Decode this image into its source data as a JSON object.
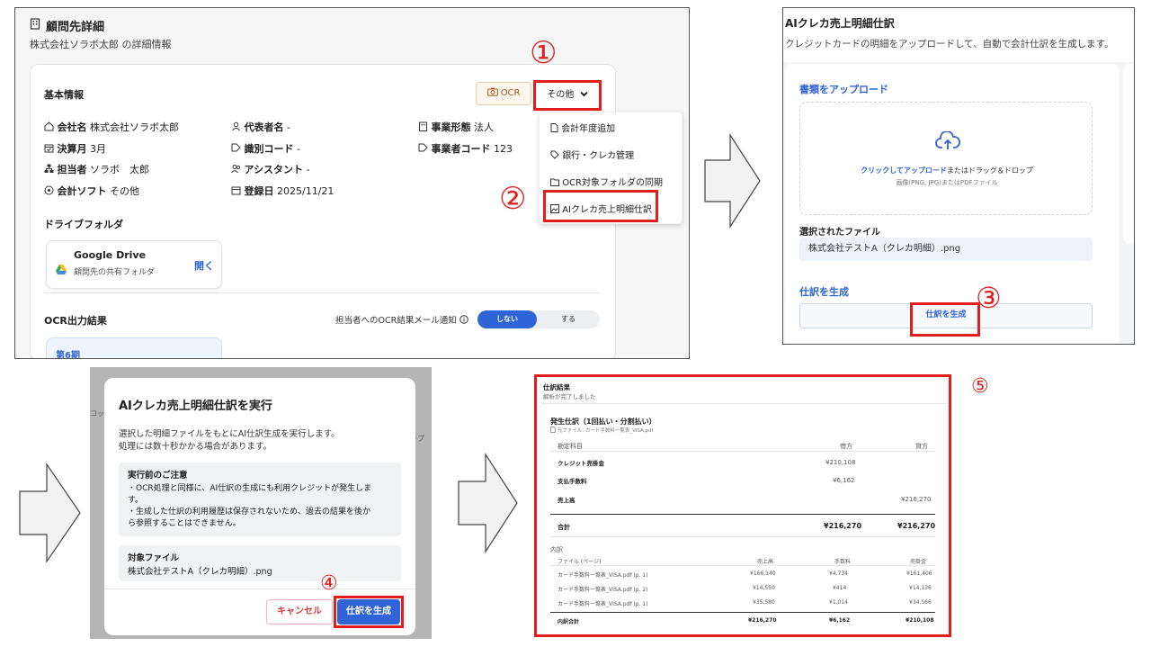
{
  "panel1": {
    "title": "顧問先詳細",
    "subtitle": "株式会社ソラボ太郎 の詳細情報",
    "basic_info_heading": "基本情報",
    "ocr_button": "OCR",
    "other_button": "その他",
    "fields": {
      "company_label": "会社名",
      "company_value": "株式会社ソラボ太郎",
      "rep_label": "代表者名",
      "rep_value": "-",
      "business_type_label": "事業形態",
      "business_type_value": "法人",
      "fiscal_month_label": "決算月",
      "fiscal_month_value": "3月",
      "id_code_label": "識別コード",
      "id_code_value": "-",
      "business_code_label": "事業者コード",
      "business_code_value": "123",
      "manager_label": "担当者",
      "manager_value": "ソラボ　太郎",
      "assistant_label": "アシスタント",
      "assistant_value": "-",
      "software_label": "会計ソフト",
      "software_value": "その他",
      "registered_label": "登録日",
      "registered_value": "2025/11/21"
    },
    "menu": {
      "item1": "会計年度追加",
      "item2": "銀行・クレカ管理",
      "item3": "OCR対象フォルダの同期",
      "item4": "AIクレカ売上明細仕訳"
    },
    "drive_heading": "ドライブフォルダ",
    "drive_title": "Google Drive",
    "drive_sub": "顧問先の共有フォルダ",
    "drive_open": "開く",
    "ocr_results_heading": "OCR出力結果",
    "notify_label": "担当者へのOCR結果メール通知",
    "toggle_off_label": "しない",
    "toggle_on_label": "する",
    "period_label": "第6期",
    "step1": "①",
    "step2": "②"
  },
  "panel2": {
    "title": "AIクレカ売上明細仕訳",
    "subtitle": "クレジットカードの明細をアップロードして、自動で会計仕訳を生成します。",
    "upload_heading": "書類をアップロード",
    "drop_link": "クリックしてアップロード",
    "drop_rest": "またはドラッグ＆ドロップ",
    "drop_hint": "画像(PNG, JPG)またはPDFファイル",
    "selected_heading": "選択されたファイル",
    "selected_file": "株式会社テストA（クレカ明細）.png",
    "generate_heading": "仕訳を生成",
    "generate_button": "仕訳を生成",
    "step3": "③"
  },
  "panel3": {
    "title": "AIクレカ売上明細仕訳を実行",
    "desc1": "選択した明細ファイルをもとにAI仕訳生成を実行します。",
    "desc2": "処理には数十秒かかる場合があります。",
    "note_title": "実行前のご注意",
    "note1": "・OCR処理と同様に、AI仕訳の生成にも利用クレジットが発生しま",
    "note1b": "す。",
    "note2": "・生成した仕訳の利用履歴は保存されないため、過去の結果を後か",
    "note2b": "ら参照することはできません。",
    "target_title": "対象ファイル",
    "target_file": "株式会社テストA（クレカ明細）.png",
    "cancel_button": "キャンセル",
    "generate_button": "仕訳を生成",
    "step4": "④",
    "bg_text1": "コッ",
    "bg_text2": "ップ"
  },
  "panel4": {
    "title": "仕訳結果",
    "subtitle": "解析が完了しました",
    "section_title": "発生仕訳（1回払い・分割払い）",
    "source_file": "元ファイル: カード手数料一覧表_VISA.pdf",
    "col_account": "勘定科目",
    "col_debit": "借方",
    "col_credit": "貸方",
    "rows": [
      {
        "account": "クレジット売掛金",
        "debit": "¥210,108",
        "credit": ""
      },
      {
        "account": "支払手数料",
        "debit": "¥6,162",
        "credit": ""
      },
      {
        "account": "売上高",
        "debit": "",
        "credit": "¥216,270"
      }
    ],
    "total_label": "合計",
    "total_debit": "¥216,270",
    "total_credit": "¥216,270",
    "breakdown_heading": "内訳",
    "bcol_file": "ファイル (ページ)",
    "bcol_sales": "売上高",
    "bcol_fee": "手数料",
    "bcol_receivable": "売掛金",
    "brows": [
      {
        "file": "カード手数料一覧表_VISA.pdf (p. 1)",
        "sales": "¥166,140",
        "fee": "¥4,734",
        "receivable": "¥161,406"
      },
      {
        "file": "カード手数料一覧表_VISA.pdf (p. 2)",
        "sales": "¥14,550",
        "fee": "¥414",
        "receivable": "¥14,136"
      },
      {
        "file": "カード手数料一覧表_VISA.pdf (p. 1)",
        "sales": "¥35,580",
        "fee": "¥1,014",
        "receivable": "¥34,566"
      }
    ],
    "btotal_label": "内訳合計",
    "btotal_sales": "¥216,270",
    "btotal_fee": "¥6,162",
    "btotal_receivable": "¥210,108",
    "step5": "⑤"
  },
  "colors": {
    "accent_blue": "#2f63d8",
    "highlight_red": "#e01e1e",
    "ocr_orange": "#a55a1c"
  }
}
